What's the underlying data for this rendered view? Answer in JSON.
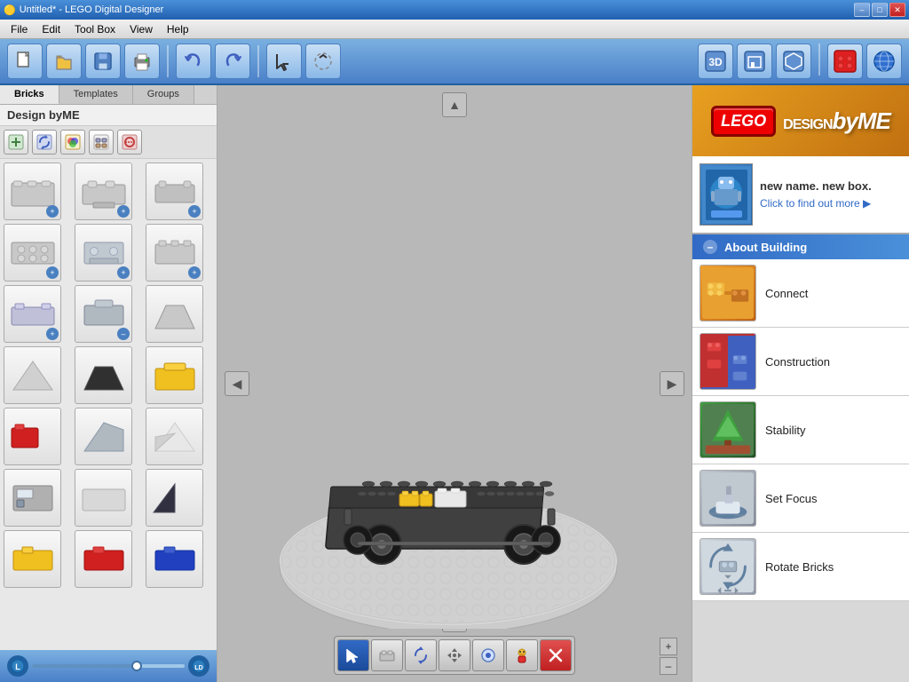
{
  "titlebar": {
    "title": "Untitled* - LEGO Digital Designer",
    "controls": {
      "minimize": "–",
      "maximize": "□",
      "close": "✕"
    }
  },
  "menubar": {
    "items": [
      "File",
      "Edit",
      "Tool Box",
      "View",
      "Help"
    ]
  },
  "toolbar": {
    "left_buttons": [
      "📄",
      "📂",
      "💾",
      "🖨️",
      "↩",
      "↪",
      "⬆",
      "❓"
    ],
    "right_buttons": [
      "🖱️",
      "❓",
      "🔵",
      "📦",
      "🧱",
      "🌐"
    ]
  },
  "left_panel": {
    "tabs": [
      "Bricks",
      "Templates",
      "Groups"
    ],
    "active_tab": "Bricks",
    "design_label": "Design byME",
    "filter_icons": [
      "➕",
      "🔄",
      "🎨",
      "📐",
      "🔃"
    ],
    "bricks": [
      {
        "color": "gray",
        "has_plus": true
      },
      {
        "color": "gray",
        "has_plus": true
      },
      {
        "color": "gray",
        "has_plus": true
      },
      {
        "color": "gray",
        "has_plus": true
      },
      {
        "color": "gray",
        "has_plus": true
      },
      {
        "color": "gray",
        "has_plus": true
      },
      {
        "color": "gray",
        "has_plus": true
      },
      {
        "color": "gray",
        "has_plus": true
      },
      {
        "color": "gray",
        "has_plus": true
      },
      {
        "color": "gray",
        "has_minus": true
      },
      {
        "color": "gray",
        "has_plus": true
      },
      {
        "color": "gray"
      },
      {
        "color": "gray"
      },
      {
        "color": "darkgray"
      },
      {
        "color": "yellow"
      },
      {
        "color": "red"
      },
      {
        "color": "gray"
      },
      {
        "color": "white"
      },
      {
        "color": "gray"
      },
      {
        "color": "gray"
      },
      {
        "color": "darkblack"
      },
      {
        "color": "yellow"
      },
      {
        "color": "red"
      },
      {
        "color": "blue"
      }
    ]
  },
  "canvas": {
    "tools": [
      "cursor",
      "brick",
      "rotate",
      "move",
      "color",
      "character",
      "delete"
    ]
  },
  "right_panel": {
    "lego_label": "LEGO",
    "design_label": "DESIGNbyME",
    "promo": {
      "title": "new name. new box.",
      "cta": "Click to find out more ▶"
    },
    "section_title": "About Building",
    "guides": [
      {
        "label": "Connect",
        "thumb_type": "connect"
      },
      {
        "label": "Construction",
        "thumb_type": "construction"
      },
      {
        "label": "Stability",
        "thumb_type": "stability"
      },
      {
        "label": "Set Focus",
        "thumb_type": "setfocus"
      },
      {
        "label": "Rotate Bricks",
        "thumb_type": "rotatebricks"
      }
    ]
  }
}
